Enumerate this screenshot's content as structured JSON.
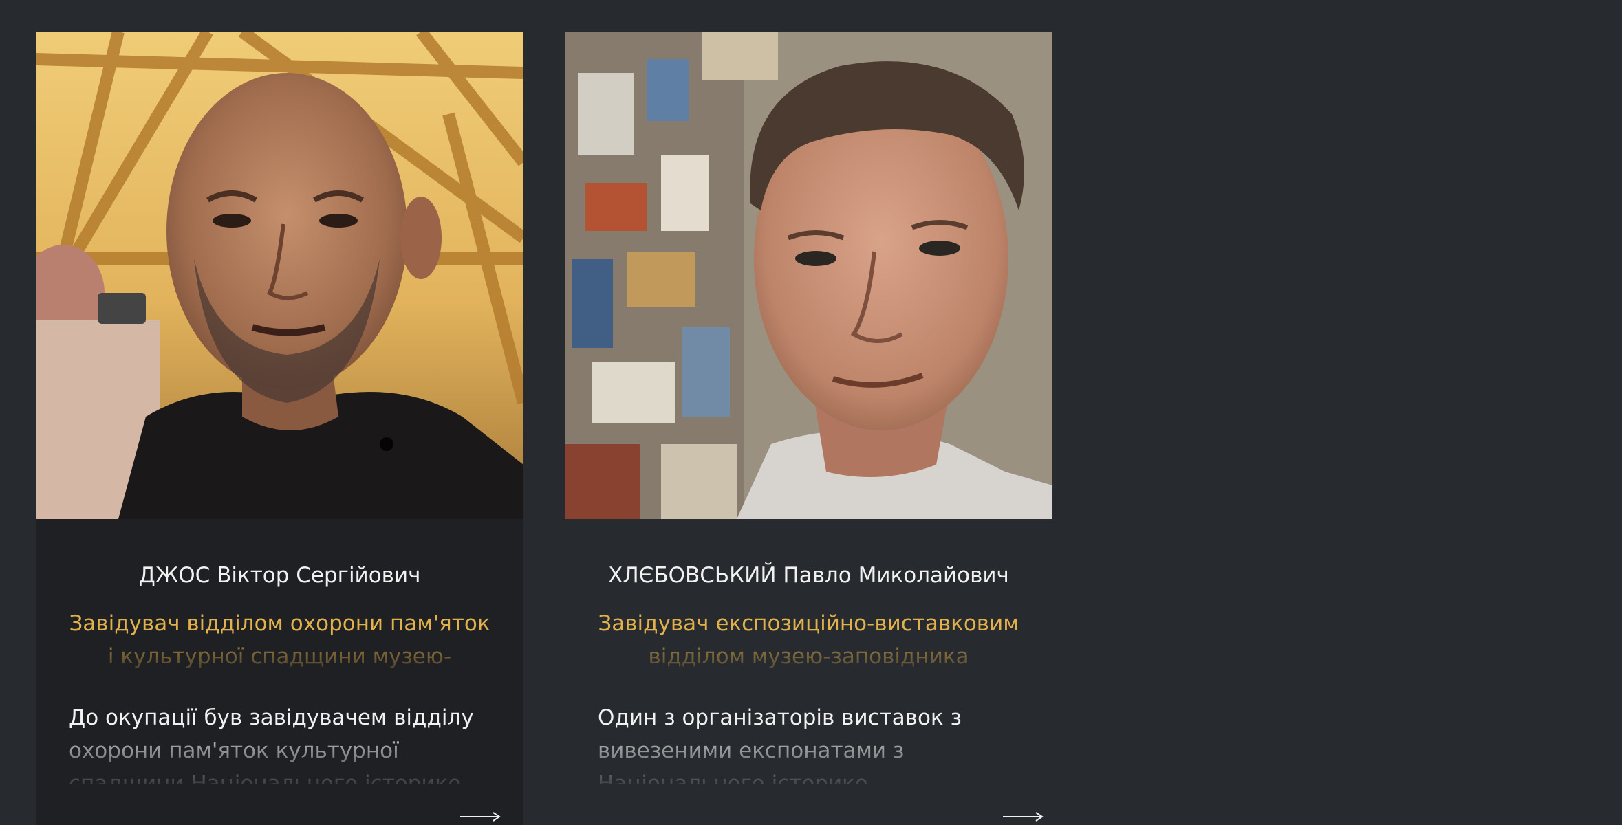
{
  "people": [
    {
      "name": "ДЖОС Віктор Сергійович",
      "position": "Завідувач відділом охорони пам'яток і культурної спадщини музею-заповідника \"Кам'яна Могила\"",
      "description": "До окупації був завідувачем відділу охорони пам'яток культурної спадщини Національного історико-",
      "photo_icon": "portrait-photo",
      "more_icon": "arrow-right-icon"
    },
    {
      "name": "ХЛЄБОВСЬКИЙ Павло Миколайович",
      "position": "Завідувач експозиційно-виставковим відділом музею-заповідника \"Херсонес Таврійський\"",
      "description": "Один з організаторів виставок з вивезеними експонатами з Національного історико-",
      "photo_icon": "portrait-photo",
      "more_icon": "arrow-right-icon"
    }
  ],
  "colors": {
    "page_background": "#272a2e",
    "card_background": "#1f2024",
    "name_text": "#f1f1f1",
    "position_text": "#e1b14b"
  }
}
